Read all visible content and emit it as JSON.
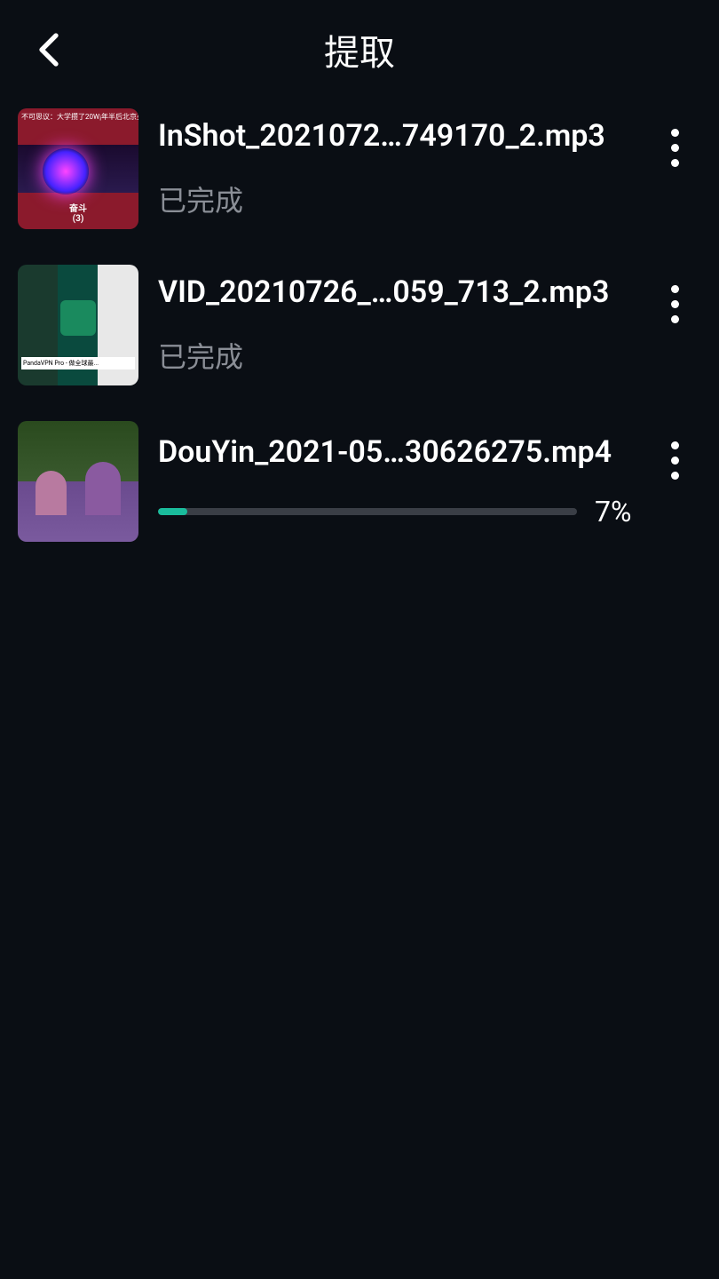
{
  "header": {
    "title": "提取"
  },
  "items": [
    {
      "title": "InShot_2021072…749170_2.mp3",
      "status": "已完成",
      "type": "complete"
    },
    {
      "title": "VID_20210726_…059_713_2.mp3",
      "status": "已完成",
      "type": "complete"
    },
    {
      "title": "DouYin_2021-05…30626275.mp4",
      "progress": 7,
      "progressText": "7%",
      "type": "progress"
    }
  ]
}
